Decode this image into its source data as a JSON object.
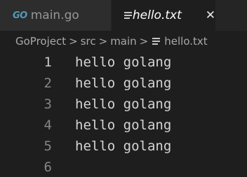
{
  "tabs": [
    {
      "label": "main.go",
      "icon": "go-file-icon",
      "active": false
    },
    {
      "label": "hello.txt",
      "icon": "text-file-icon",
      "active": true
    }
  ],
  "go_icon_text": "GO",
  "close_glyph": "✕",
  "breadcrumb": {
    "items": [
      "GoProject",
      "src",
      "main",
      "hello.txt"
    ],
    "separator": ">"
  },
  "editor": {
    "lines": [
      {
        "number": "1",
        "text": "hello golang"
      },
      {
        "number": "2",
        "text": "hello golang"
      },
      {
        "number": "3",
        "text": "hello golang"
      },
      {
        "number": "4",
        "text": "hello golang"
      },
      {
        "number": "5",
        "text": "hello golang"
      },
      {
        "number": "6",
        "text": ""
      }
    ],
    "current_line": 1
  },
  "colors": {
    "editor_bg": "#1e1e1e",
    "tabbar_bg": "#252526",
    "inactive_tab_bg": "#2d2d2d",
    "go_icon": "#519aba",
    "text": "#d4d4d4",
    "line_number": "#858585"
  }
}
